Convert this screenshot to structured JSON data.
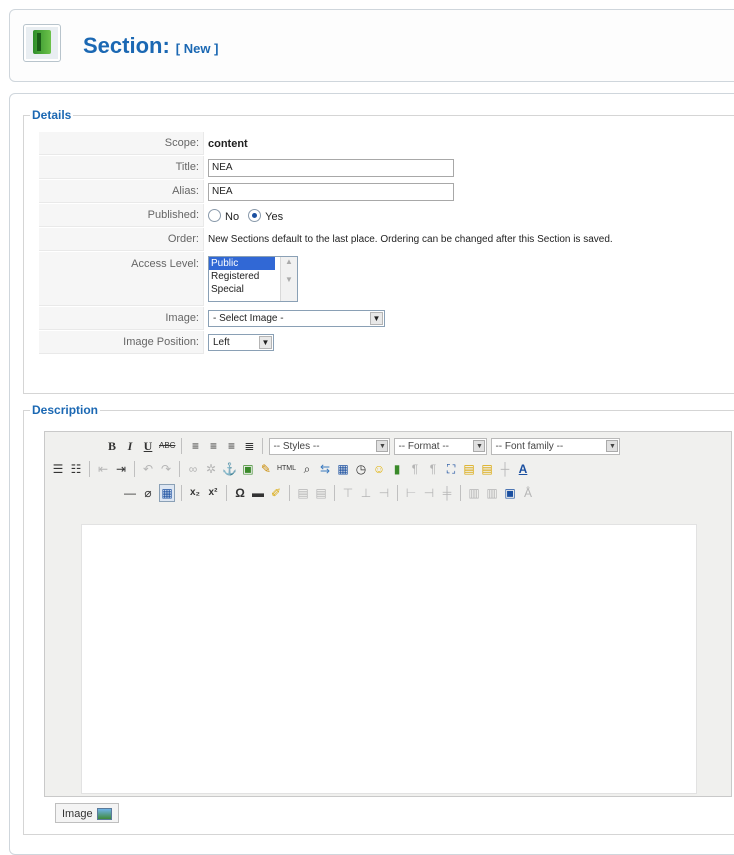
{
  "header": {
    "title": "Section:",
    "subtitle": "[ New ]"
  },
  "details": {
    "legend": "Details",
    "scope_label": "Scope:",
    "scope_value": "content",
    "title_label": "Title:",
    "title_value": "NEA",
    "alias_label": "Alias:",
    "alias_value": "NEA",
    "published_label": "Published:",
    "published_no": "No",
    "published_yes": "Yes",
    "published_selected": "Yes",
    "order_label": "Order:",
    "order_text": "New Sections default to the last place. Ordering can be changed after this Section is saved.",
    "access_label": "Access Level:",
    "access_options": [
      "Public",
      "Registered",
      "Special"
    ],
    "access_selected": "Public",
    "image_label": "Image:",
    "image_value": "- Select Image -",
    "image_position_label": "Image Position:",
    "image_position_value": "Left"
  },
  "description": {
    "legend": "Description",
    "toolbar": {
      "styles": "-- Styles --",
      "format": "-- Format --",
      "font_family": "-- Font family --"
    },
    "image_button": "Image"
  },
  "icons": [
    "app-section-icon",
    "bold-icon",
    "italic-icon",
    "underline-icon",
    "strikethrough-icon",
    "align-left-icon",
    "align-center-icon",
    "align-right-icon",
    "justify-icon",
    "bullet-list-icon",
    "numbered-list-icon",
    "outdent-icon",
    "indent-icon",
    "undo-icon",
    "redo-icon",
    "link-icon",
    "unlink-icon",
    "anchor-icon",
    "image-icon",
    "cleanup-icon",
    "html-icon",
    "find-icon",
    "replace-icon",
    "insert-date-icon",
    "insert-time-icon",
    "emoticons-icon",
    "media-icon",
    "ltr-icon",
    "rtl-icon",
    "fullscreen-icon",
    "paste-text-icon",
    "paste-word-icon",
    "select-all-icon",
    "text-color-icon",
    "horizontal-rule-icon",
    "remove-format-icon",
    "visual-aid-icon",
    "subscript-icon",
    "superscript-icon",
    "special-char-icon",
    "advanced-hr-icon",
    "insert-edit-icon",
    "table-icon"
  ]
}
